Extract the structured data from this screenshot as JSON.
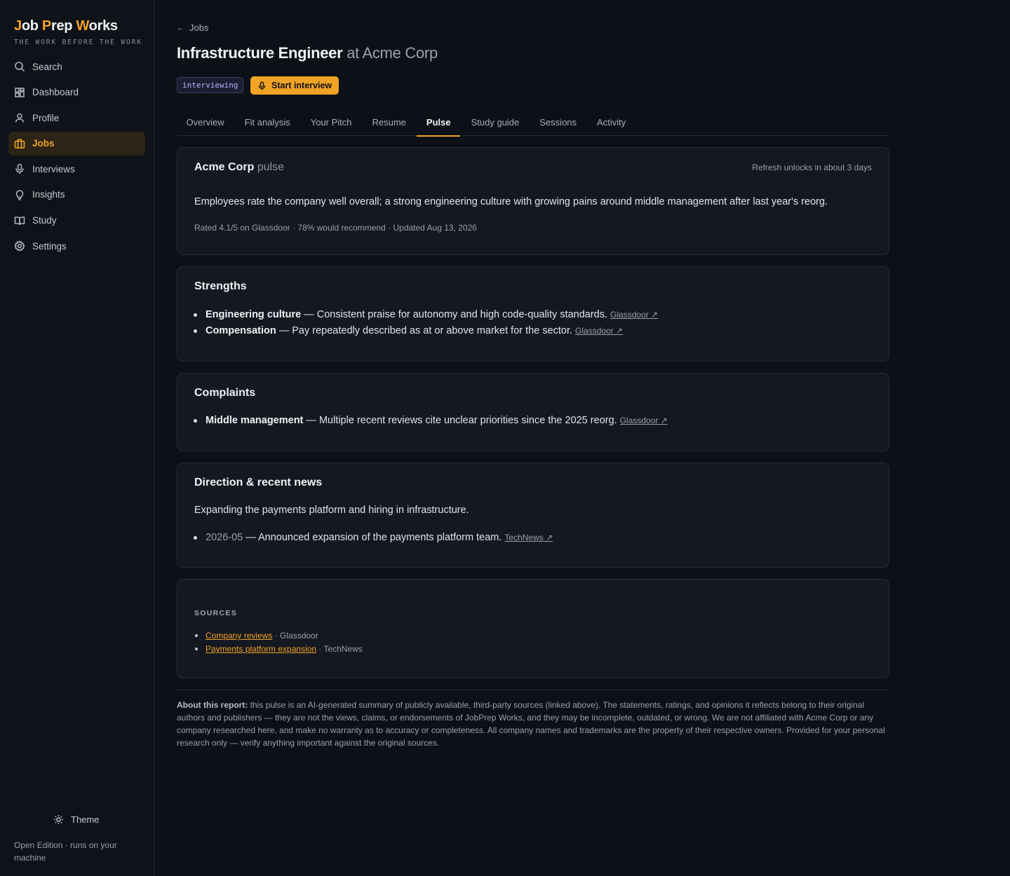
{
  "brand": {
    "title_pre": "J",
    "title_1": "ob ",
    "title_2": "P",
    "title_3": "rep ",
    "title_4": "W",
    "title_5": "orks",
    "tagline": "THE WORK BEFORE THE WORK"
  },
  "sidebar": {
    "items": [
      {
        "label": "Search",
        "icon": "search-icon"
      },
      {
        "label": "Dashboard",
        "icon": "dashboard-icon"
      },
      {
        "label": "Profile",
        "icon": "user-icon"
      },
      {
        "label": "Jobs",
        "icon": "briefcase-icon",
        "active": true
      },
      {
        "label": "Interviews",
        "icon": "microphone-icon"
      },
      {
        "label": "Insights",
        "icon": "lightbulb-icon"
      },
      {
        "label": "Study",
        "icon": "book-icon"
      },
      {
        "label": "Settings",
        "icon": "gear-icon"
      }
    ],
    "theme_label": "Theme",
    "edition": "Open Edition · runs on your machine"
  },
  "header": {
    "back_label": "Jobs",
    "job_title": "Infrastructure Engineer",
    "company_suffix": "at Acme Corp",
    "status": "interviewing",
    "start_label": "Start interview"
  },
  "tabs": [
    "Overview",
    "Fit analysis",
    "Your Pitch",
    "Resume",
    "Pulse",
    "Study guide",
    "Sessions",
    "Activity"
  ],
  "active_tab": "Pulse",
  "pulse": {
    "company": "Acme Corp",
    "suffix": "pulse",
    "refresh": "Refresh unlocks in about 3 days",
    "summary": "Employees rate the company well overall; a strong engineering culture with growing pains around middle management after last year's reorg.",
    "meta": "Rated 4.1/5 on Glassdoor · 78% would recommend · Updated Aug 13, 2026"
  },
  "strengths": {
    "title": "Strengths",
    "items": [
      {
        "name": "Engineering culture",
        "text": " — Consistent praise for autonomy and high code-quality standards.",
        "source": "Glassdoor ↗"
      },
      {
        "name": "Compensation",
        "text": " — Pay repeatedly described as at or above market for the sector.",
        "source": "Glassdoor ↗"
      }
    ]
  },
  "complaints": {
    "title": "Complaints",
    "items": [
      {
        "name": "Middle management",
        "text": " — Multiple recent reviews cite unclear priorities since the 2025 reorg.",
        "source": "Glassdoor ↗"
      }
    ]
  },
  "direction": {
    "title": "Direction & recent news",
    "summary": "Expanding the payments platform and hiring in infrastructure.",
    "items": [
      {
        "date": "2026-05",
        "text": " — Announced expansion of the payments platform team.",
        "source": "TechNews ↗"
      }
    ]
  },
  "sources": {
    "label": "SOURCES",
    "items": [
      {
        "title": "Company reviews",
        "publisher": " · Glassdoor"
      },
      {
        "title": "Payments platform expansion",
        "publisher": " · TechNews"
      }
    ]
  },
  "disclaimer": {
    "lead": "About this report:",
    "text": " this pulse is an AI-generated summary of publicly available, third-party sources (linked above). The statements, ratings, and opinions it reflects belong to their original authors and publishers — they are not the views, claims, or endorsements of JobPrep Works, and they may be incomplete, outdated, or wrong. We are not affiliated with Acme Corp or any company researched here, and make no warranty as to accuracy or completeness. All company names and trademarks are the property of their respective owners. Provided for your personal research only — verify anything important against the original sources."
  },
  "colors": {
    "accent": "#f0a324",
    "background": "#0d1117",
    "card": "#141821",
    "badge": "#b7b3ff"
  }
}
